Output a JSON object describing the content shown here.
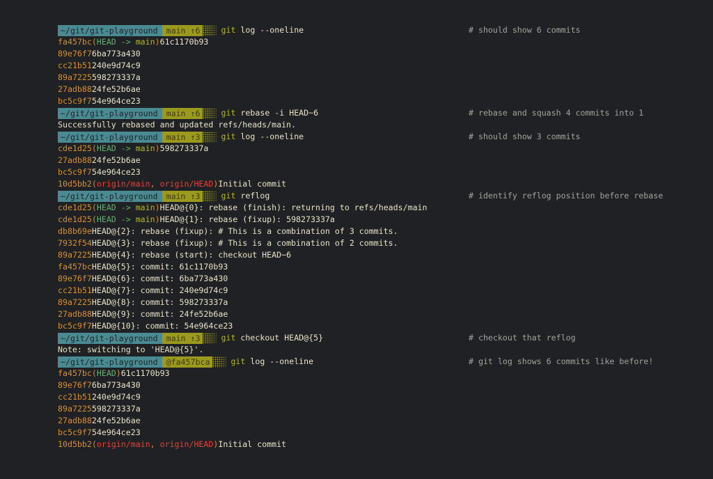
{
  "prompt": {
    "path": "~/git/git-playground"
  },
  "lines": [
    {
      "type": "prompt",
      "branch": "main ↑6",
      "git": "git",
      "args": "log --oneline",
      "comment": "# should show 6 commits"
    },
    {
      "type": "log",
      "hash": "fa457bc",
      "refs": "head_main",
      "msg": "61c1170b93"
    },
    {
      "type": "log",
      "hash": "89e76f7",
      "msg": "6ba773a430"
    },
    {
      "type": "log",
      "hash": "cc21b51",
      "msg": "240e9d74c9"
    },
    {
      "type": "log",
      "hash": "89a7225",
      "msg": "598273337a"
    },
    {
      "type": "log",
      "hash": "27adb88",
      "msg": "24fe52b6ae"
    },
    {
      "type": "log",
      "hash": "bc5c9f7",
      "msg": "54e964ce23"
    },
    {
      "type": "prompt",
      "branch": "main ↑6",
      "git": "git",
      "args": "rebase -i HEAD~6",
      "comment": "# rebase and squash 4 commits into 1"
    },
    {
      "type": "output",
      "text": "Successfully rebased and updated refs/heads/main."
    },
    {
      "type": "prompt",
      "branch": "main ↑3",
      "git": "git",
      "args": "log --oneline",
      "comment": "# should show 3 commits"
    },
    {
      "type": "log",
      "hash": "cde1d25",
      "refs": "head_main",
      "msg": "598273337a"
    },
    {
      "type": "log",
      "hash": "27adb88",
      "msg": "24fe52b6ae"
    },
    {
      "type": "log",
      "hash": "bc5c9f7",
      "msg": "54e964ce23"
    },
    {
      "type": "log",
      "hash": "10d5bb2",
      "refs": "origin",
      "msg": "Initial commit"
    },
    {
      "type": "prompt",
      "branch": "main ↑3",
      "git": "git",
      "args": "reflog",
      "comment": "# identify reflog position before rebase"
    },
    {
      "type": "log",
      "hash": "cde1d25",
      "refs": "head_main",
      "msg": "HEAD@{0}: rebase (finish): returning to refs/heads/main"
    },
    {
      "type": "log",
      "hash": "cde1d25",
      "refs": "head_main",
      "msg": "HEAD@{1}: rebase (fixup): 598273337a"
    },
    {
      "type": "log",
      "hash": "db8b69e",
      "msg": "HEAD@{2}: rebase (fixup): # This is a combination of 3 commits."
    },
    {
      "type": "log",
      "hash": "7932f54",
      "msg": "HEAD@{3}: rebase (fixup): # This is a combination of 2 commits."
    },
    {
      "type": "log",
      "hash": "89a7225",
      "msg": "HEAD@{4}: rebase (start): checkout HEAD~6"
    },
    {
      "type": "log",
      "hash": "fa457bc",
      "msg": "HEAD@{5}: commit: 61c1170b93"
    },
    {
      "type": "log",
      "hash": "89e76f7",
      "msg": "HEAD@{6}: commit: 6ba773a430"
    },
    {
      "type": "log",
      "hash": "cc21b51",
      "msg": "HEAD@{7}: commit: 240e9d74c9"
    },
    {
      "type": "log",
      "hash": "89a7225",
      "msg": "HEAD@{8}: commit: 598273337a"
    },
    {
      "type": "log",
      "hash": "27adb88",
      "msg": "HEAD@{9}: commit: 24fe52b6ae"
    },
    {
      "type": "log",
      "hash": "bc5c9f7",
      "msg": "HEAD@{10}: commit: 54e964ce23"
    },
    {
      "type": "prompt",
      "branch": "main ↑3",
      "git": "git",
      "args": "checkout HEAD@{5}",
      "comment": "# checkout that reflog"
    },
    {
      "type": "output",
      "text": "Note: switching to 'HEAD@{5}'."
    },
    {
      "type": "prompt",
      "branch": "@fa457bca",
      "git": "git",
      "args": "log --oneline",
      "comment": "# git log shows 6 commits like before!"
    },
    {
      "type": "log",
      "hash": "fa457bc",
      "refs": "head_only",
      "msg": "61c1170b93"
    },
    {
      "type": "log",
      "hash": "89e76f7",
      "msg": "6ba773a430"
    },
    {
      "type": "log",
      "hash": "cc21b51",
      "msg": "240e9d74c9"
    },
    {
      "type": "log",
      "hash": "89a7225",
      "msg": "598273337a"
    },
    {
      "type": "log",
      "hash": "27adb88",
      "msg": "24fe52b6ae"
    },
    {
      "type": "log",
      "hash": "bc5c9f7",
      "msg": "54e964ce23"
    },
    {
      "type": "log",
      "hash": "10d5bb2",
      "refs": "origin",
      "msg": "Initial commit"
    }
  ],
  "refs": {
    "head": "HEAD",
    "arrow": " -> ",
    "main": "main",
    "origin_main": "origin/main",
    "sep": ", ",
    "origin_head": "origin/HEAD",
    "open": "(",
    "close": ")"
  },
  "colors": {
    "background": "#1f2124",
    "path_segment": "#4a8a93",
    "branch_segment": "#9c9a1e",
    "hash": "#d6902e",
    "head_ref": "#5fb36e",
    "branch_ref": "#b6b52b",
    "origin_ref": "#ee3d36",
    "text": "#e8e3c8",
    "comment": "#a3a39b"
  }
}
